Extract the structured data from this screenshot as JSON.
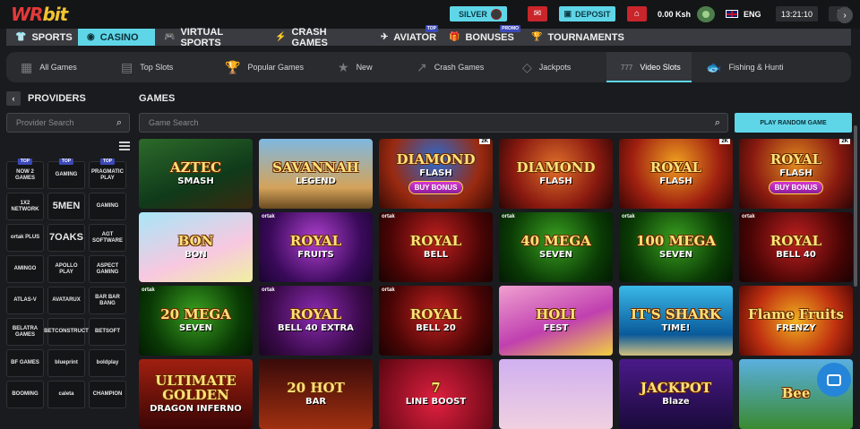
{
  "header": {
    "logo_main": "WR",
    "logo_accent": "bit",
    "vip_level": "SILVER",
    "deposit_label": "DEPOSIT",
    "balance": "0.00 Ksh",
    "language": "ENG",
    "time": "13:21:10"
  },
  "main_nav": [
    {
      "label": "SPORTS",
      "icon": "shirt-icon",
      "glyph": "👕",
      "active": false,
      "tag": ""
    },
    {
      "label": "CASINO",
      "icon": "chip-icon",
      "glyph": "◉",
      "active": true,
      "tag": ""
    },
    {
      "label": "VIRTUAL SPORTS",
      "icon": "gamepad-icon",
      "glyph": "🎮",
      "active": false,
      "tag": ""
    },
    {
      "label": "CRASH GAMES",
      "icon": "bolt-icon",
      "glyph": "⚡",
      "active": false,
      "tag": ""
    },
    {
      "label": "AVIATOR",
      "icon": "plane-icon",
      "glyph": "✈",
      "active": false,
      "tag": "TOP"
    },
    {
      "label": "BONUSES",
      "icon": "gift-icon",
      "glyph": "🎁",
      "active": false,
      "tag": "PROMO"
    },
    {
      "label": "TOURNAMENTS",
      "icon": "trophy-icon",
      "glyph": "🏆",
      "active": false,
      "tag": ""
    }
  ],
  "categories": [
    {
      "label": "All Games",
      "icon": "grid-icon",
      "glyph": "▦",
      "active": false
    },
    {
      "label": "Top Slots",
      "icon": "slot-reels-icon",
      "glyph": "▤",
      "active": false
    },
    {
      "label": "Popular Games",
      "icon": "trophy-icon",
      "glyph": "🏆",
      "active": false
    },
    {
      "label": "New",
      "icon": "star-icon",
      "glyph": "★",
      "active": false
    },
    {
      "label": "Crash Games",
      "icon": "trend-up-icon",
      "glyph": "↗",
      "active": false
    },
    {
      "label": "Jackpots",
      "icon": "diamond-icon",
      "glyph": "◇",
      "active": false
    },
    {
      "label": "Video Slots",
      "icon": "777-icon",
      "glyph": "777",
      "active": true
    },
    {
      "label": "Fishing & Hunti",
      "icon": "fish-icon",
      "glyph": "🐟",
      "active": false
    }
  ],
  "providers_title": "PROVIDERS",
  "games_title": "GAMES",
  "provider_search_placeholder": "Provider Search",
  "game_search_placeholder": "Game Search",
  "random_game_label": "PLAY RANDOM GAME",
  "providers": [
    {
      "name": "NOW 2 GAMES",
      "tag": "TOP",
      "big": false
    },
    {
      "name": "GAMING",
      "tag": "TOP",
      "big": false
    },
    {
      "name": "PRAGMATIC PLAY",
      "tag": "TOP",
      "big": false
    },
    {
      "name": "1X2 NETWORK",
      "tag": "",
      "big": false
    },
    {
      "name": "5MEN",
      "tag": "",
      "big": true
    },
    {
      "name": "GAMING",
      "tag": "",
      "big": false
    },
    {
      "name": "ortak PLUS",
      "tag": "",
      "big": false
    },
    {
      "name": "7OAKS",
      "tag": "",
      "big": true
    },
    {
      "name": "AGT SOFTWARE",
      "tag": "",
      "big": false
    },
    {
      "name": "AMINGO",
      "tag": "",
      "big": false
    },
    {
      "name": "APOLLO PLAY",
      "tag": "",
      "big": false
    },
    {
      "name": "ASPECT GAMING",
      "tag": "",
      "big": false
    },
    {
      "name": "ATLAS-V",
      "tag": "",
      "big": false
    },
    {
      "name": "AVATARUX",
      "tag": "",
      "big": false
    },
    {
      "name": "BAR BAR BANG",
      "tag": "",
      "big": false
    },
    {
      "name": "BELATRA GAMES",
      "tag": "",
      "big": false
    },
    {
      "name": "BETCONSTRUCT",
      "tag": "",
      "big": false
    },
    {
      "name": "BETSOFT",
      "tag": "",
      "big": false
    },
    {
      "name": "BF GAMES",
      "tag": "",
      "big": false
    },
    {
      "name": "blueprint",
      "tag": "",
      "big": false
    },
    {
      "name": "boldplay",
      "tag": "",
      "big": false
    },
    {
      "name": "BOOMING",
      "tag": "",
      "big": false
    },
    {
      "name": "caleta",
      "tag": "",
      "big": false
    },
    {
      "name": "CHAMPION",
      "tag": "",
      "big": false
    }
  ],
  "games": [
    {
      "title": "AZTEC",
      "subtitle": "SMASH",
      "bonus": "",
      "provider": "",
      "corner": "",
      "bg": "linear-gradient(160deg,#2d6a2a,#0f3a1a 60%,#3a2a10)"
    },
    {
      "title": "SAVANNAH",
      "subtitle": "LEGEND",
      "bonus": "",
      "provider": "",
      "corner": "",
      "bg": "linear-gradient(180deg,#7fb8e0,#d4a35a 70%,#6a4a20)"
    },
    {
      "title": "DIAMOND",
      "subtitle": "FLASH",
      "bonus": "BUY BONUS",
      "provider": "",
      "corner": "2K",
      "bg": "radial-gradient(circle at 50% 30%,#2a6ad0,#9a2a10 60%,#3a0a05)"
    },
    {
      "title": "DIAMOND",
      "subtitle": "FLASH",
      "bonus": "",
      "provider": "",
      "corner": "",
      "bg": "radial-gradient(circle at 50% 40%,#e0702a,#8a1a10 60%,#2a0505)"
    },
    {
      "title": "ROYAL",
      "subtitle": "FLASH",
      "bonus": "",
      "provider": "",
      "corner": "2K",
      "bg": "radial-gradient(circle at 50% 35%,#f0a020,#a02010 60%,#3a0505)"
    },
    {
      "title": "ROYAL",
      "subtitle": "FLASH",
      "bonus": "BUY BONUS",
      "provider": "",
      "corner": "2K",
      "bg": "radial-gradient(circle at 50% 35%,#e08a20,#8a1a10 60%,#2a0505)"
    },
    {
      "title": "BON",
      "subtitle": "BON",
      "bonus": "",
      "provider": "",
      "corner": "",
      "bg": "linear-gradient(160deg,#a8e6f8,#f8c8e0 60%,#f0f0a0)"
    },
    {
      "title": "ROYAL",
      "subtitle": "FRUITS",
      "bonus": "",
      "provider": "ortak",
      "corner": "",
      "bg": "radial-gradient(circle at 50% 40%,#b040d0,#3a0a5a 65%,#1a0530)"
    },
    {
      "title": "ROYAL",
      "subtitle": "BELL",
      "bonus": "",
      "provider": "ortak",
      "corner": "",
      "bg": "radial-gradient(circle at 50% 40%,#c02020,#4a0505 65%,#1a0202)"
    },
    {
      "title": "40 MEGA",
      "subtitle": "SEVEN",
      "bonus": "",
      "provider": "ortak",
      "corner": "",
      "bg": "radial-gradient(circle at 50% 40%,#3aa020,#0a3a05 65%,#021a02)"
    },
    {
      "title": "100 MEGA",
      "subtitle": "SEVEN",
      "bonus": "",
      "provider": "ortak",
      "corner": "",
      "bg": "radial-gradient(circle at 50% 40%,#3aa020,#0a3a05 65%,#021a02)"
    },
    {
      "title": "ROYAL",
      "subtitle": "BELL 40",
      "bonus": "",
      "provider": "ortak",
      "corner": "",
      "bg": "radial-gradient(circle at 50% 40%,#c02020,#4a0505 65%,#1a0202)"
    },
    {
      "title": "20 MEGA",
      "subtitle": "SEVEN",
      "bonus": "",
      "provider": "ortak",
      "corner": "",
      "bg": "radial-gradient(circle at 50% 40%,#3aa020,#0a3a05 65%,#021a02)"
    },
    {
      "title": "ROYAL",
      "subtitle": "BELL 40 EXTRA",
      "bonus": "",
      "provider": "ortak",
      "corner": "",
      "bg": "radial-gradient(circle at 50% 40%,#8a2ab0,#3a0a4a 65%,#1a0520)"
    },
    {
      "title": "ROYAL",
      "subtitle": "BELL 20",
      "bonus": "",
      "provider": "ortak",
      "corner": "",
      "bg": "radial-gradient(circle at 50% 40%,#c02020,#4a0505 65%,#1a0202)"
    },
    {
      "title": "HOLI",
      "subtitle": "FEST",
      "bonus": "",
      "provider": "",
      "corner": "",
      "bg": "linear-gradient(160deg,#f0a0d0,#c040b0 55%,#f0d040)"
    },
    {
      "title": "IT'S SHARK",
      "subtitle": "TIME!",
      "bonus": "",
      "provider": "",
      "corner": "",
      "bg": "linear-gradient(180deg,#3ab8e8,#0a5a9a 70%,#d0c080)"
    },
    {
      "title": "Flame Fruits",
      "subtitle": "FRENZY",
      "bonus": "",
      "provider": "",
      "corner": "",
      "bg": "radial-gradient(circle at 50% 50%,#f0b020,#c03010 60%,#5a0a05)"
    },
    {
      "title": "ULTIMATE GOLDEN",
      "subtitle": "DRAGON INFERNO",
      "bonus": "",
      "provider": "",
      "corner": "",
      "bg": "linear-gradient(180deg,#a02010,#3a0505)"
    },
    {
      "title": "20 HOT",
      "subtitle": "BAR",
      "bonus": "",
      "provider": "",
      "corner": "",
      "bg": "linear-gradient(180deg,#3a0a0a,#a03010)"
    },
    {
      "title": "7",
      "subtitle": "LINE BOOST",
      "bonus": "",
      "provider": "",
      "corner": "",
      "bg": "radial-gradient(circle at 50% 60%,#e02040,#5a0510)"
    },
    {
      "title": "",
      "subtitle": "",
      "bonus": "",
      "provider": "",
      "corner": "",
      "bg": "linear-gradient(180deg,#d0b0f0,#f0d0e0)"
    },
    {
      "title": "JACKPOT",
      "subtitle": "Blaze",
      "bonus": "",
      "provider": "",
      "corner": "",
      "bg": "linear-gradient(180deg,#4a1a8a,#1a0a3a)"
    },
    {
      "title": "Bee",
      "subtitle": "",
      "bonus": "",
      "provider": "",
      "corner": "",
      "bg": "linear-gradient(180deg,#5ab0e0,#3a8a30)"
    }
  ]
}
